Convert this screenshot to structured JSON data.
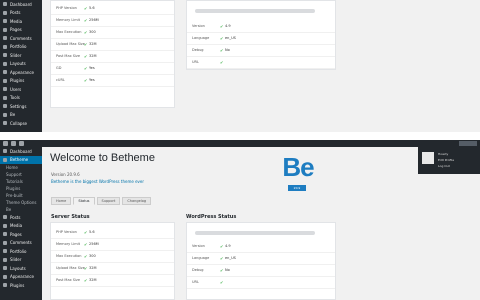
{
  "top": {
    "sidebar": [
      "Dashboard",
      "Posts",
      "Media",
      "Pages",
      "Comments",
      "Portfolio",
      "Slider",
      "Layouts",
      "Appearance",
      "Plugins",
      "Users",
      "Tools",
      "Settings",
      "Be",
      "Collapse"
    ],
    "left_card_rows": [
      {
        "k": "PHP Version",
        "v": "5.6"
      },
      {
        "k": "Memory Limit",
        "v": "256M"
      },
      {
        "k": "Max Execution",
        "v": "300"
      },
      {
        "k": "Upload Max Size",
        "v": "32M"
      },
      {
        "k": "Post Max Size",
        "v": "32M"
      },
      {
        "k": "GD",
        "v": "Yes"
      },
      {
        "k": "cURL",
        "v": "Yes"
      }
    ],
    "right_card_rows": [
      {
        "k": "Version",
        "v": "4.9"
      },
      {
        "k": "Language",
        "v": "en_US"
      },
      {
        "k": "Debug",
        "v": "No"
      },
      {
        "k": "URL",
        "v": ""
      }
    ]
  },
  "bottom": {
    "sidebar": [
      "Dashboard",
      "Betheme",
      "Home",
      "Support",
      "Tutorials",
      "Plugins",
      "Pre-built",
      "Theme Options",
      "Be",
      "Posts",
      "Media",
      "Pages",
      "Comments",
      "Portfolio",
      "Slider",
      "Layouts",
      "Appearance",
      "Plugins"
    ],
    "welcome_title": "Welcome to Betheme",
    "version": "Version 20.9.6",
    "subtitle": "Betheme is the biggest WordPress theme ever",
    "logo_text": "Be",
    "logo_badge": "20.9",
    "tabs": [
      "Home",
      "Status",
      "Support",
      "Changelog"
    ],
    "active_tab": 1,
    "left_section_title": "Server Status",
    "right_section_title": "WordPress Status",
    "left_card_rows": [
      {
        "k": "PHP Version",
        "v": "5.6"
      },
      {
        "k": "Memory Limit",
        "v": "256M"
      },
      {
        "k": "Max Execution",
        "v": "300"
      },
      {
        "k": "Upload Max Size",
        "v": "32M"
      },
      {
        "k": "Post Max Size",
        "v": "32M"
      }
    ],
    "right_card_rows": [
      {
        "k": "Version",
        "v": "4.9"
      },
      {
        "k": "Language",
        "v": "en_US"
      },
      {
        "k": "Debug",
        "v": "No"
      },
      {
        "k": "URL",
        "v": ""
      }
    ],
    "notice_lines": [
      "Howdy",
      "Edit Profile",
      "Log Out"
    ]
  }
}
